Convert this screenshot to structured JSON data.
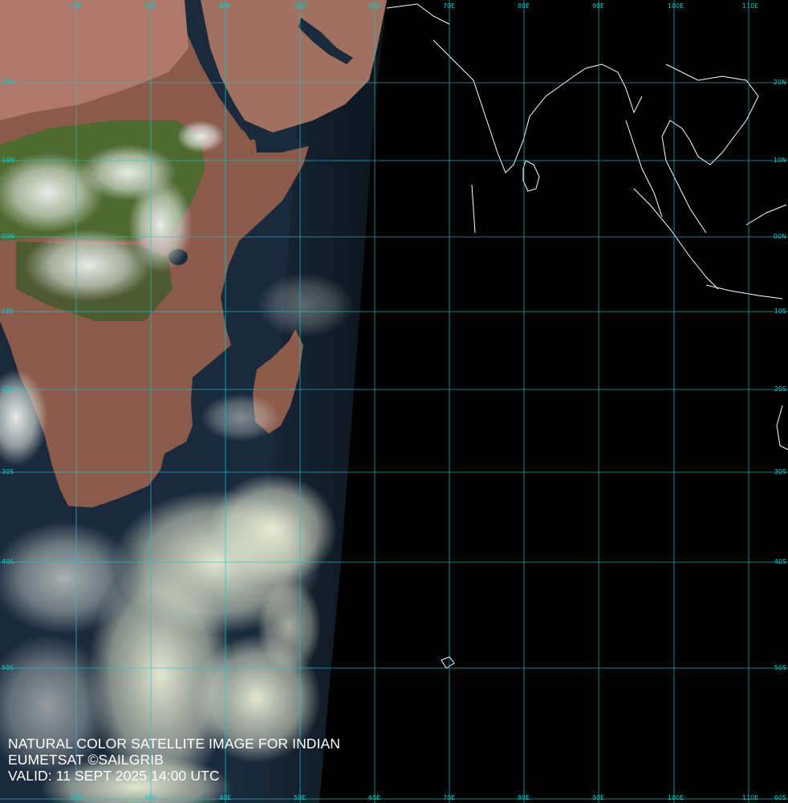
{
  "map": {
    "longitude_labels_top": [
      "20E",
      "30E",
      "40E",
      "50E",
      "60E",
      "70E",
      "80E",
      "90E",
      "100E",
      "110E"
    ],
    "longitude_labels_bottom": [
      "20E",
      "30E",
      "40E",
      "50E",
      "60E",
      "70E",
      "80E",
      "90E",
      "100E",
      "110E"
    ],
    "latitude_labels_left": [
      "20N",
      "10N",
      "00N",
      "10S",
      "20S",
      "30S",
      "40S",
      "50S"
    ],
    "latitude_labels_right": [
      "20N",
      "10N",
      "00N",
      "10S",
      "20S",
      "30S",
      "40S",
      "50S",
      "60S"
    ],
    "grid_color": "#19c7cf",
    "coastline_color": "#ffffff",
    "night_color": "#000000"
  },
  "caption": {
    "line1": "NATURAL COLOR SATELLITE IMAGE FOR INDIAN",
    "line2": "EUMETSAT ©SAILGRIB",
    "line3": "VALID:  11 SEPT 2025 14:00 UTC"
  }
}
